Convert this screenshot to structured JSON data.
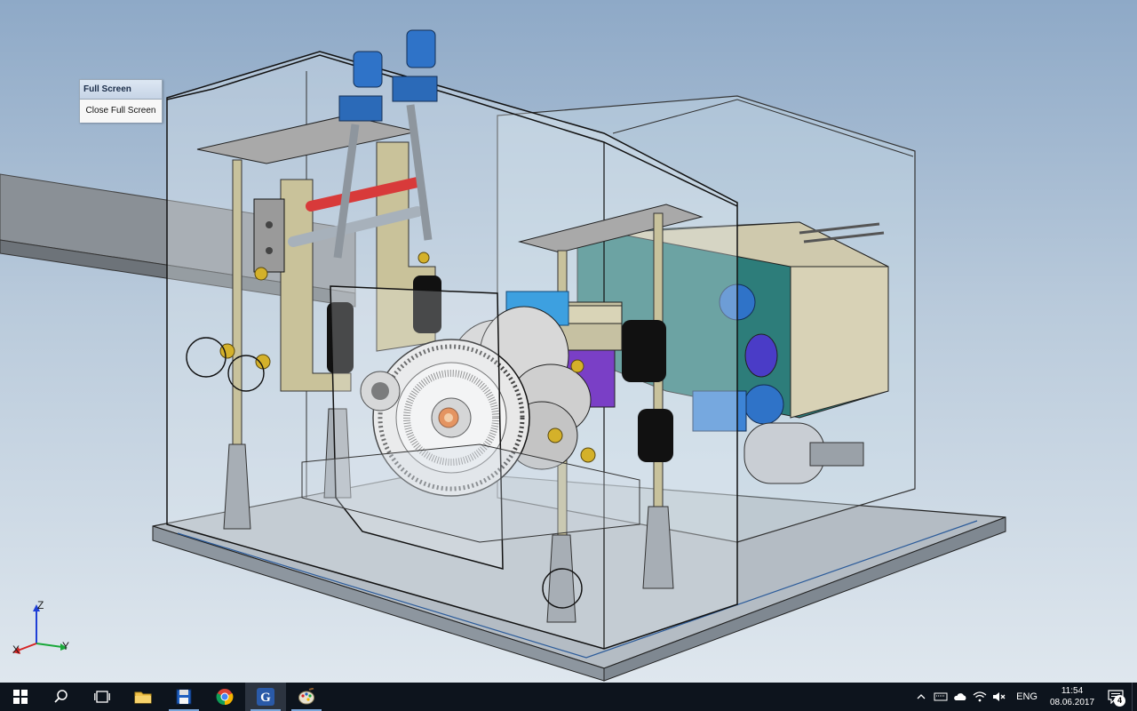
{
  "fullscreen_toolbar": {
    "title": "Full Screen",
    "close_label": "Close Full Screen"
  },
  "triad": {
    "z": "Z",
    "x": "X",
    "y": "Y"
  },
  "taskbar": {
    "apps": [
      {
        "name": "start",
        "icon": "windows-logo-icon"
      },
      {
        "name": "search",
        "icon": "search-icon"
      },
      {
        "name": "task-view",
        "icon": "task-view-icon"
      },
      {
        "name": "file-explorer",
        "icon": "folder-icon"
      },
      {
        "name": "save-app",
        "icon": "floppy-disk-icon"
      },
      {
        "name": "chrome",
        "icon": "chrome-icon"
      },
      {
        "name": "cad-app",
        "icon": "g-letter-icon"
      },
      {
        "name": "paint-app",
        "icon": "palette-icon"
      }
    ],
    "tray": {
      "language": "ENG",
      "time": "11:54",
      "date": "08.06.2017",
      "notifications": "4"
    }
  },
  "colors": {
    "desktop_top": "#8ea9c7",
    "taskbar": "#0d141d",
    "frame": "#b4bcc4",
    "gear_body": "#e8e8e8",
    "bracket": "#c9c29a",
    "motor": "#2f73c8",
    "cabinet": "#2d7d7a",
    "rod_red": "#d83a3a",
    "copper": "#e0752f"
  }
}
